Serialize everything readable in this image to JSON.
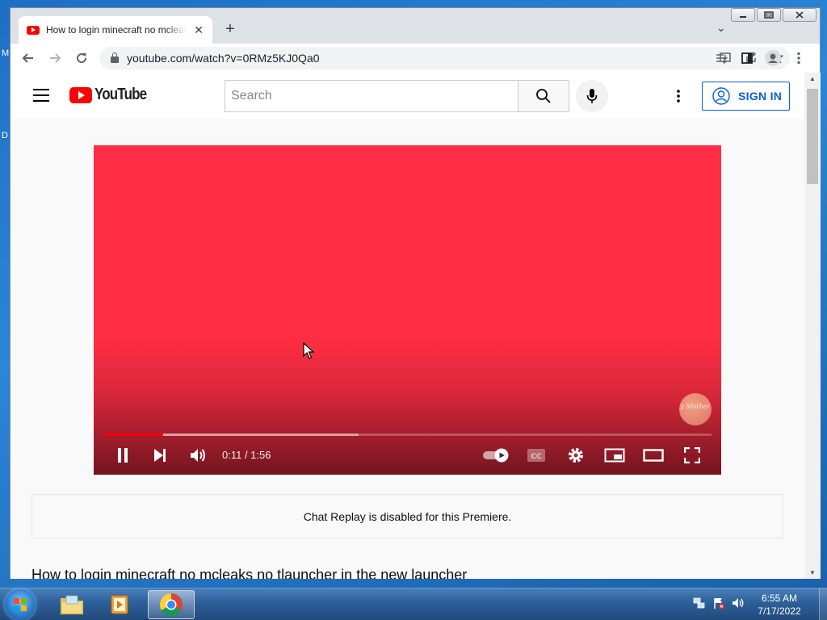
{
  "desktop": {
    "edge_glyph_top": "M",
    "edge_glyph_mid": "D"
  },
  "browser": {
    "tab": {
      "title": "How to login minecraft no mcleaks no tlauncher in the new launcher",
      "close": "✕"
    },
    "new_tab_label": "+",
    "url": "youtube.com/watch?v=0RMz5KJ0Qa0",
    "icons": [
      "back-icon",
      "forward-icon",
      "reload-icon",
      "lock-icon",
      "install-icon",
      "share-icon",
      "bookmark-star-icon",
      "reading-list-icon",
      "side-panel-icon",
      "profile-icon",
      "menu-icon"
    ]
  },
  "youtube": {
    "logo_text": "YouTube",
    "search": {
      "placeholder": "Search"
    },
    "sign_in_label": "SIGN IN",
    "player": {
      "time_display": "0:11 / 1:56",
      "played_fraction": 0.098,
      "buffered_fraction": 0.42,
      "state": "playing",
      "autoplay_on": true,
      "watermark_text": "Happy Mothers Day",
      "background_color": "#ff2e44"
    },
    "chat_replay_message": "Chat Replay is disabled for this Premiere.",
    "video_title": "How to login minecraft no mcleaks no tlauncher in the new launcher"
  },
  "taskbar": {
    "clock_time": "6:55 AM",
    "clock_date": "7/17/2022",
    "apps": [
      "windows-explorer-icon",
      "media-player-icon",
      "chrome-icon"
    ]
  },
  "colors": {
    "youtube_red": "#ff0000",
    "link_blue": "#065fd4"
  }
}
